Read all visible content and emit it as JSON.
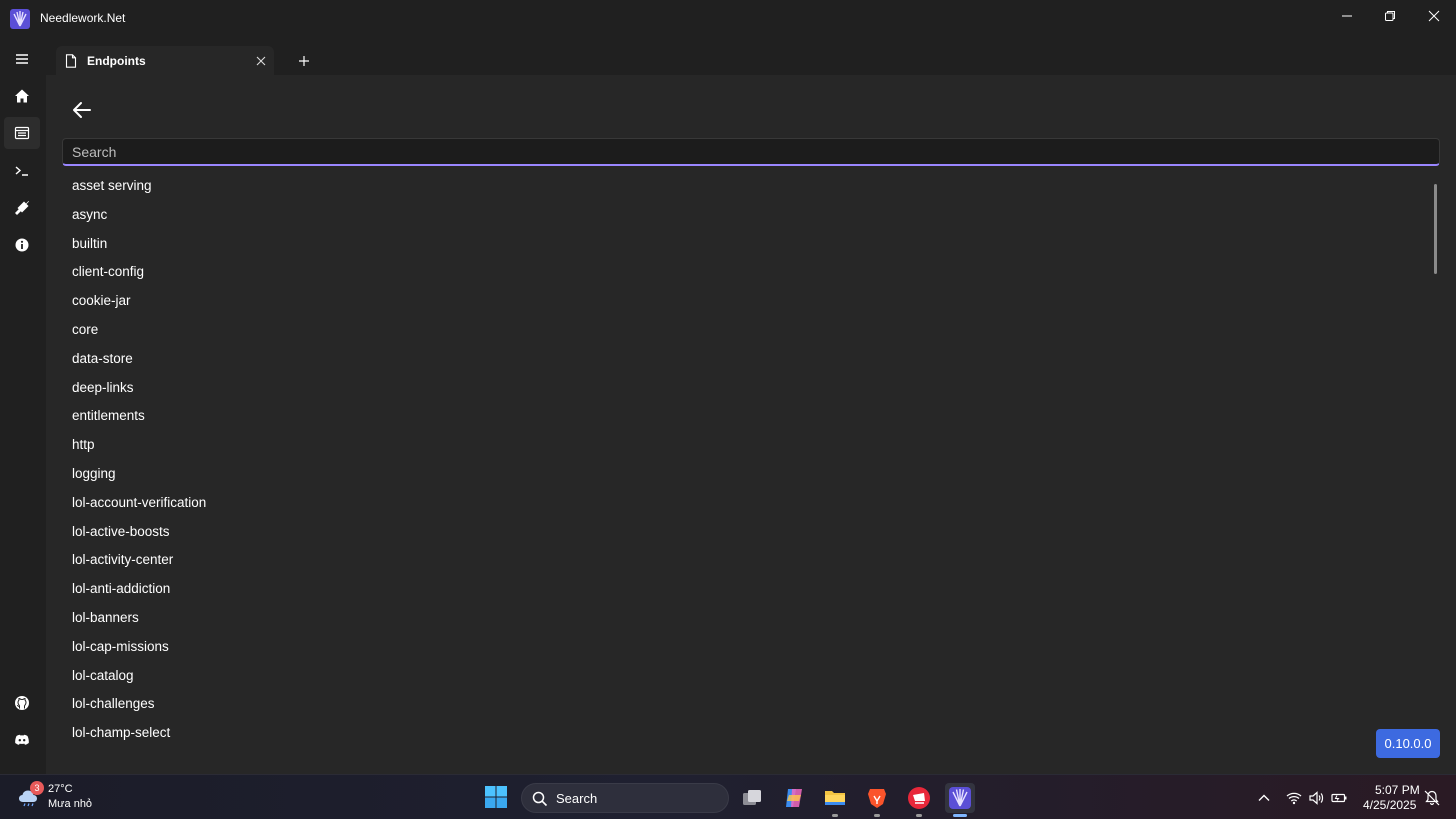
{
  "app": {
    "title": "Needlework.Net"
  },
  "tab": {
    "label": "Endpoints",
    "add_label": "+"
  },
  "search": {
    "placeholder": "Search"
  },
  "endpoints": [
    "asset serving",
    "async",
    "builtin",
    "client-config",
    "cookie-jar",
    "core",
    "data-store",
    "deep-links",
    "entitlements",
    "http",
    "logging",
    "lol-account-verification",
    "lol-active-boosts",
    "lol-activity-center",
    "lol-anti-addiction",
    "lol-banners",
    "lol-cap-missions",
    "lol-catalog",
    "lol-challenges",
    "lol-champ-select"
  ],
  "version": "0.10.0.0",
  "sidebar": {
    "items": [
      "menu-icon",
      "home-icon",
      "endpoints-icon",
      "console-icon",
      "plugin-icon",
      "info-icon"
    ],
    "bottom": [
      "github-icon",
      "discord-icon"
    ],
    "active_index": 2
  },
  "taskbar": {
    "weather": {
      "badge": "3",
      "temp": "27°C",
      "desc": "Mưa nhỏ"
    },
    "search_label": "Search",
    "clock": {
      "time": "5:07 PM",
      "date": "4/25/2025"
    }
  },
  "colors": {
    "accent": "#9a86ff",
    "version_badge": "#3d6ae0",
    "background": "#272727"
  }
}
